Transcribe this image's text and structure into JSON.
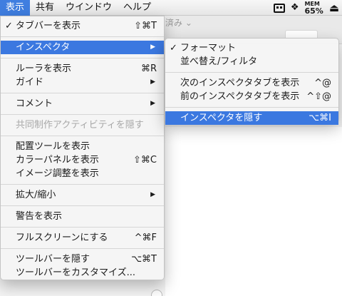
{
  "menubar": {
    "items": [
      "表示",
      "共有",
      "ウインドウ",
      "ヘルプ"
    ],
    "active_index": 0,
    "status": {
      "mem_label": "MEM",
      "mem_value": "65%"
    }
  },
  "background": {
    "hint_text": "済み ⌄"
  },
  "view_menu": {
    "g1": {
      "toolbar_show": "タブバーを表示",
      "toolbar_show_sc": "⇧⌘T",
      "inspector": "インスペクタ"
    },
    "g2": {
      "rulers": "ルーラを表示",
      "rulers_sc": "⌘R",
      "guides": "ガイド"
    },
    "g3": {
      "comments": "コメント"
    },
    "g4": {
      "collab": "共同制作アクティビティを隠す"
    },
    "g5": {
      "arrange": "配置ツールを表示",
      "colors": "カラーパネルを表示",
      "colors_sc": "⇧⌘C",
      "adjust": "イメージ調整を表示"
    },
    "g6": {
      "zoom": "拡大/縮小"
    },
    "g7": {
      "warnings": "警告を表示"
    },
    "g8": {
      "fullscreen": "フルスクリーンにする",
      "fullscreen_sc": "^⌘F"
    },
    "g9": {
      "hide_toolbar": "ツールバーを隠す",
      "hide_toolbar_sc": "⌥⌘T",
      "customize": "ツールバーをカスタマイズ..."
    }
  },
  "inspector_menu": {
    "format": "フォーマット",
    "sort": "並べ替え/フィルタ",
    "next_tab": "次のインスペクタタブを表示",
    "next_tab_sc": "^@",
    "prev_tab": "前のインスペクタタブを表示",
    "prev_tab_sc": "^⇧@",
    "hide": "インスペクタを隠す",
    "hide_sc": "⌥⌘I"
  },
  "colors": {
    "highlight": "#3b78e0",
    "menubar_active": "#3f7ee0"
  },
  "icons": {
    "check": "checkmark-icon",
    "submenu": "submenu-arrow-icon"
  }
}
